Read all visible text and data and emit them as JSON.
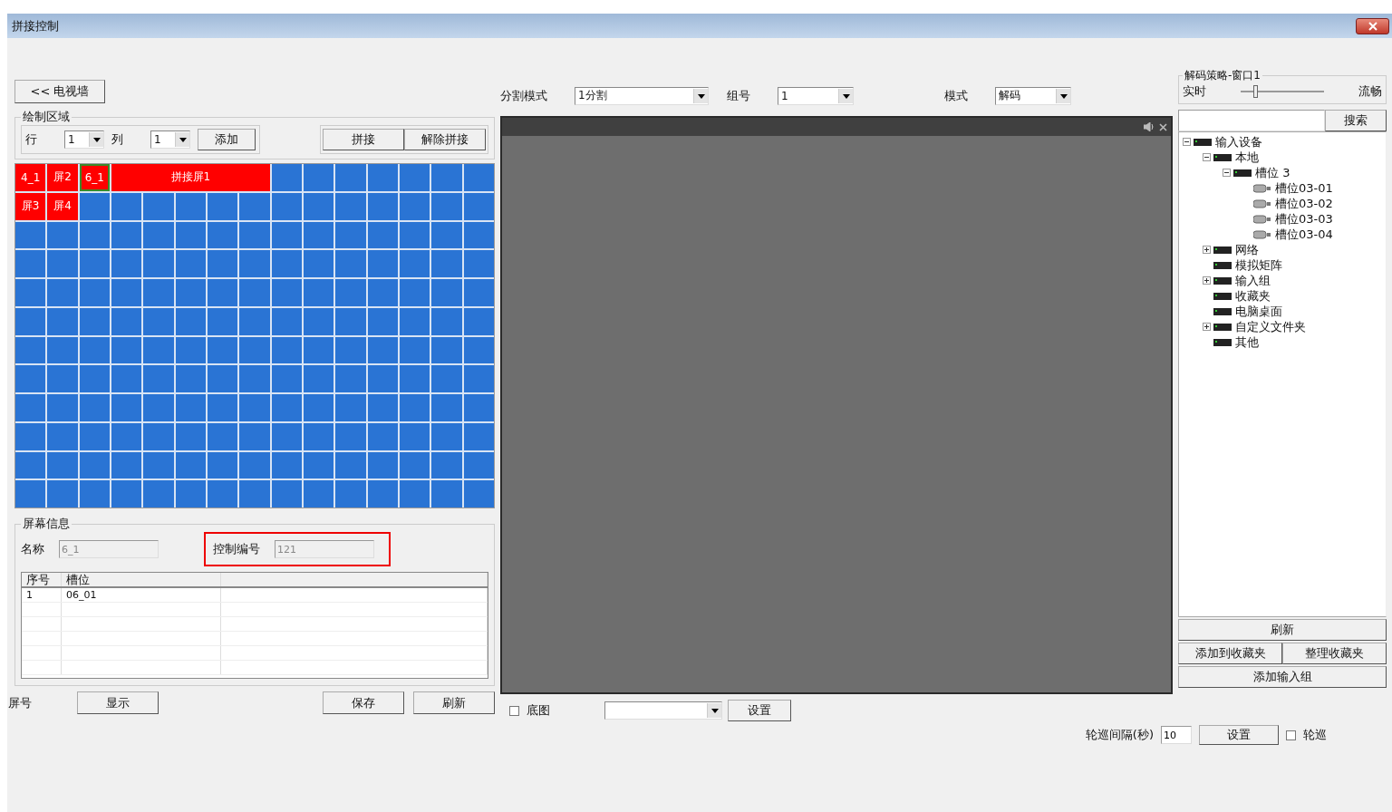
{
  "window": {
    "title": "拼接控制"
  },
  "tv_wall_button": "<< 电视墙",
  "draw_area": {
    "title": "绘制区域",
    "row_label": "行",
    "row_value": "1",
    "col_label": "列",
    "col_value": "1",
    "add_button": "添加",
    "splice_button": "拼接",
    "unsplice_button": "解除拼接"
  },
  "wall": {
    "rows": [
      {
        "screens": [
          {
            "label": "4_1",
            "selected": false,
            "kind": "single"
          },
          {
            "label": "屏2",
            "selected": false,
            "kind": "single"
          },
          {
            "label": "6_1",
            "selected": true,
            "kind": "single"
          },
          {
            "label": "拼接屏1",
            "selected": false,
            "kind": "merged",
            "parts": [
              {
                "kind": "tile"
              },
              {
                "kind": "tile"
              },
              {
                "kind": "tile"
              },
              {
                "kind": "tile"
              },
              {
                "kind": "tile"
              }
            ]
          }
        ]
      },
      {
        "screens": [
          {
            "label": "屏3",
            "selected": false,
            "kind": "single"
          },
          {
            "label": "屏4",
            "selected": false,
            "kind": "single"
          }
        ]
      }
    ]
  },
  "screen_info": {
    "title": "屏幕信息",
    "name_label": "名称",
    "name_value": "6_1",
    "control_label": "控制编号",
    "control_value": "121",
    "table": {
      "columns": [
        "序号",
        "槽位"
      ],
      "rows": [
        [
          "1",
          "06_01"
        ]
      ]
    }
  },
  "left_bottom": {
    "screen_no_label": "屏号",
    "show_button": "显示",
    "save_button": "保存",
    "refresh_button": "刷新"
  },
  "split": {
    "mode_label": "分割模式",
    "mode_value": "1分割",
    "group_label": "组号",
    "group_value": "1",
    "type_label": "模式",
    "type_value": "解码"
  },
  "video_bottom": {
    "background_label": "底图",
    "background_checked": false,
    "set_button": "设置"
  },
  "decode": {
    "title": "解码策略-窗口1",
    "left_label": "实时",
    "right_label": "流畅",
    "level": 0.15
  },
  "search": {
    "button": "搜索"
  },
  "tree": {
    "children": [
      {
        "label": "输入设备",
        "expanded": true,
        "children": [
          {
            "label": "本地",
            "expanded": true,
            "children": [
              {
                "label": "槽位 3",
                "expanded": true,
                "children": [
                  {
                    "label": "槽位03-01",
                    "kind": "channel"
                  },
                  {
                    "label": "槽位03-02",
                    "kind": "channel"
                  },
                  {
                    "label": "槽位03-03",
                    "kind": "channel"
                  },
                  {
                    "label": "槽位03-04",
                    "kind": "channel"
                  }
                ]
              }
            ]
          },
          {
            "label": "网络",
            "expanded": false
          },
          {
            "label": "模拟矩阵"
          },
          {
            "label": "输入组",
            "expanded": false
          },
          {
            "label": "收藏夹"
          },
          {
            "label": "电脑桌面"
          },
          {
            "label": "自定义文件夹",
            "expanded": false
          },
          {
            "label": "其他"
          }
        ]
      }
    ]
  },
  "right_buttons": {
    "refresh": "刷新",
    "add_favorite": "添加到收藏夹",
    "manage_favorite": "整理收藏夹",
    "add_input_group": "添加输入组"
  },
  "patrol": {
    "interval_label": "轮巡间隔(秒)",
    "interval_value": "10",
    "set_button": "设置",
    "patrol_label": "轮巡",
    "patrol_checked": false
  }
}
